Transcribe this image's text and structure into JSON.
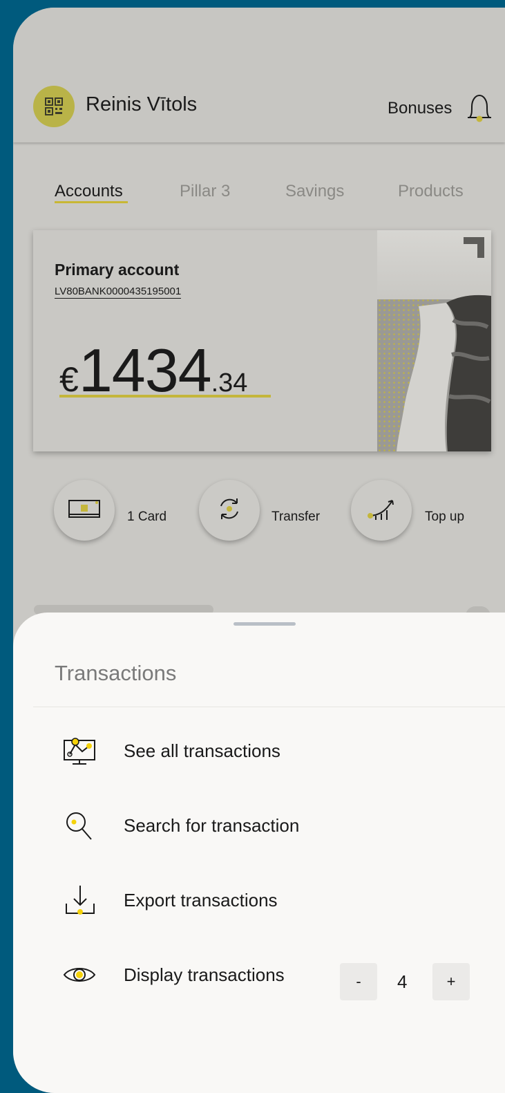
{
  "header": {
    "user_name": "Reinis Vītols",
    "bonuses_label": "Bonuses",
    "avatar_icon": "qr-code-icon",
    "bell_icon": "bell-icon"
  },
  "tabs": [
    {
      "label": "Accounts",
      "active": true
    },
    {
      "label": "Pillar 3",
      "active": false
    },
    {
      "label": "Savings",
      "active": false
    },
    {
      "label": "Products",
      "active": false
    }
  ],
  "account": {
    "title": "Primary account",
    "iban": "LV80BANK0000435195001",
    "currency": "€",
    "amount_int": "1434",
    "amount_dec": ".34"
  },
  "actions": [
    {
      "label": "1 Card",
      "icon": "card-icon"
    },
    {
      "label": "Transfer",
      "icon": "transfer-icon"
    },
    {
      "label": "Top up",
      "icon": "top-up-icon"
    }
  ],
  "sheet": {
    "title": "Transactions",
    "items": [
      {
        "label": "See all transactions",
        "icon": "monitor-chart-icon"
      },
      {
        "label": "Search for transaction",
        "icon": "search-icon"
      },
      {
        "label": "Export transactions",
        "icon": "download-icon"
      },
      {
        "label": "Display transactions",
        "icon": "eye-icon"
      }
    ],
    "stepper": {
      "minus": "-",
      "value": "4",
      "plus": "+"
    }
  },
  "colors": {
    "accent": "#f5d20a",
    "accent_dimmed": "#c4b63b",
    "background": "#005a7d",
    "sheet": "#f9f8f6"
  }
}
